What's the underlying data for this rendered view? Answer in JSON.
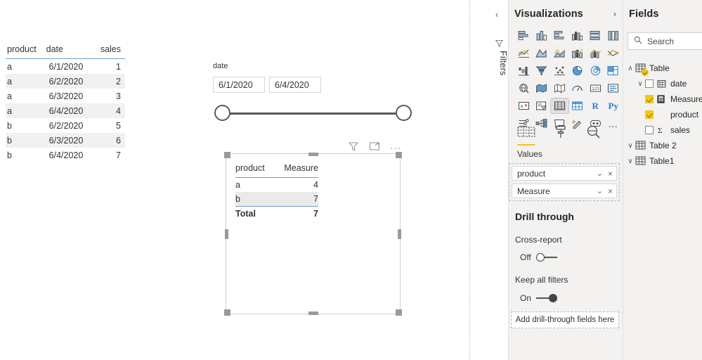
{
  "data_table": {
    "columns": [
      "product",
      "date",
      "sales"
    ],
    "rows": [
      [
        "a",
        "6/1/2020",
        "1"
      ],
      [
        "a",
        "6/2/2020",
        "2"
      ],
      [
        "a",
        "6/3/2020",
        "3"
      ],
      [
        "a",
        "6/4/2020",
        "4"
      ],
      [
        "b",
        "6/2/2020",
        "5"
      ],
      [
        "b",
        "6/3/2020",
        "6"
      ],
      [
        "b",
        "6/4/2020",
        "7"
      ]
    ]
  },
  "slicer": {
    "title": "date",
    "start_value": "6/1/2020",
    "end_value": "6/4/2020"
  },
  "visual_header": {
    "filter_icon": "filter-funnel-icon",
    "focus_icon": "focus-mode-icon",
    "more_label": "..."
  },
  "table_visual": {
    "columns": [
      "product",
      "Measure"
    ],
    "rows": [
      {
        "product": "a",
        "measure": "4",
        "highlighted": false
      },
      {
        "product": "b",
        "measure": "7",
        "highlighted": true
      }
    ],
    "total_label": "Total",
    "total_value": "7"
  },
  "filters_rail": {
    "collapse_chevron": "‹",
    "funnel_icon": "filter-funnel-icon",
    "label": "Filters"
  },
  "visualizations": {
    "title": "Visualizations",
    "expand_chevron": "›",
    "icons": [
      "stacked-bar-chart-icon",
      "stacked-column-chart-icon",
      "clustered-bar-chart-icon",
      "clustered-column-chart-icon",
      "100-stacked-bar-chart-icon",
      "100-stacked-column-chart-icon",
      "line-chart-icon",
      "area-chart-icon",
      "stacked-area-chart-icon",
      "line-stacked-column-chart-icon",
      "line-clustered-column-chart-icon",
      "ribbon-chart-icon",
      "waterfall-chart-icon",
      "funnel-chart-icon",
      "scatter-chart-icon",
      "pie-chart-icon",
      "donut-chart-icon",
      "treemap-icon",
      "map-icon",
      "filled-map-icon",
      "shape-map-icon",
      "gauge-icon",
      "card-icon",
      "multi-row-card-icon",
      "kpi-icon",
      "slicer-icon",
      "table-icon",
      "matrix-icon",
      "r-script-visual-icon",
      "python-visual-icon",
      "key-influencers-icon",
      "decomposition-tree-icon",
      "qa-visual-icon",
      "smart-narrative-icon",
      "paginated-report-icon",
      "more-visuals-icon"
    ],
    "selected_icon": "table-icon",
    "r_label": "R",
    "py_label": "Py",
    "more_label": "…",
    "well_tabs": [
      {
        "name": "fields-well-tab",
        "icon": "fields-grid-icon",
        "active": true
      },
      {
        "name": "format-tab",
        "icon": "paint-roller-icon",
        "active": false
      },
      {
        "name": "analytics-tab",
        "icon": "magnifier-analytics-icon",
        "active": false
      }
    ],
    "well_label": "Values",
    "well_fields": [
      {
        "name": "product",
        "chevron": "⌄",
        "remove": "×"
      },
      {
        "name": "Measure",
        "chevron": "⌄",
        "remove": "×"
      }
    ]
  },
  "drill_through": {
    "title": "Drill through",
    "cross_report_label": "Cross-report",
    "cross_report_state": "Off",
    "keep_filters_label": "Keep all filters",
    "keep_filters_state": "On",
    "drop_zone_text": "Add drill-through fields here"
  },
  "fields": {
    "title": "Fields",
    "search_placeholder": "Search",
    "search_icon": "search-icon",
    "tree": [
      {
        "label": "Table",
        "level": 0,
        "twist": "∧",
        "kind": "table",
        "checkbox": null,
        "badge": true
      },
      {
        "label": "date",
        "level": 1,
        "twist": "∨",
        "kind": "date",
        "checkbox": "off",
        "badge": false
      },
      {
        "label": "Measure",
        "level": 2,
        "twist": "",
        "kind": "measure",
        "checkbox": "on",
        "badge": false
      },
      {
        "label": "product",
        "level": 2,
        "twist": "",
        "kind": "none",
        "checkbox": "on",
        "badge": false
      },
      {
        "label": "sales",
        "level": 2,
        "twist": "",
        "kind": "sum",
        "checkbox": "off",
        "badge": false
      },
      {
        "label": "Table 2",
        "level": 0,
        "twist": "∨",
        "kind": "table",
        "checkbox": null,
        "badge": false
      },
      {
        "label": "Table1",
        "level": 0,
        "twist": "∨",
        "kind": "table",
        "checkbox": null,
        "badge": false
      }
    ]
  },
  "colors": {
    "accent_yellow": "#f2c811",
    "header_rule_blue": "#6f9ec6",
    "pane_bg": "#f3f2f1",
    "icon_blue": "#2a7fc9",
    "row_stripe": "#f1f1f1"
  }
}
